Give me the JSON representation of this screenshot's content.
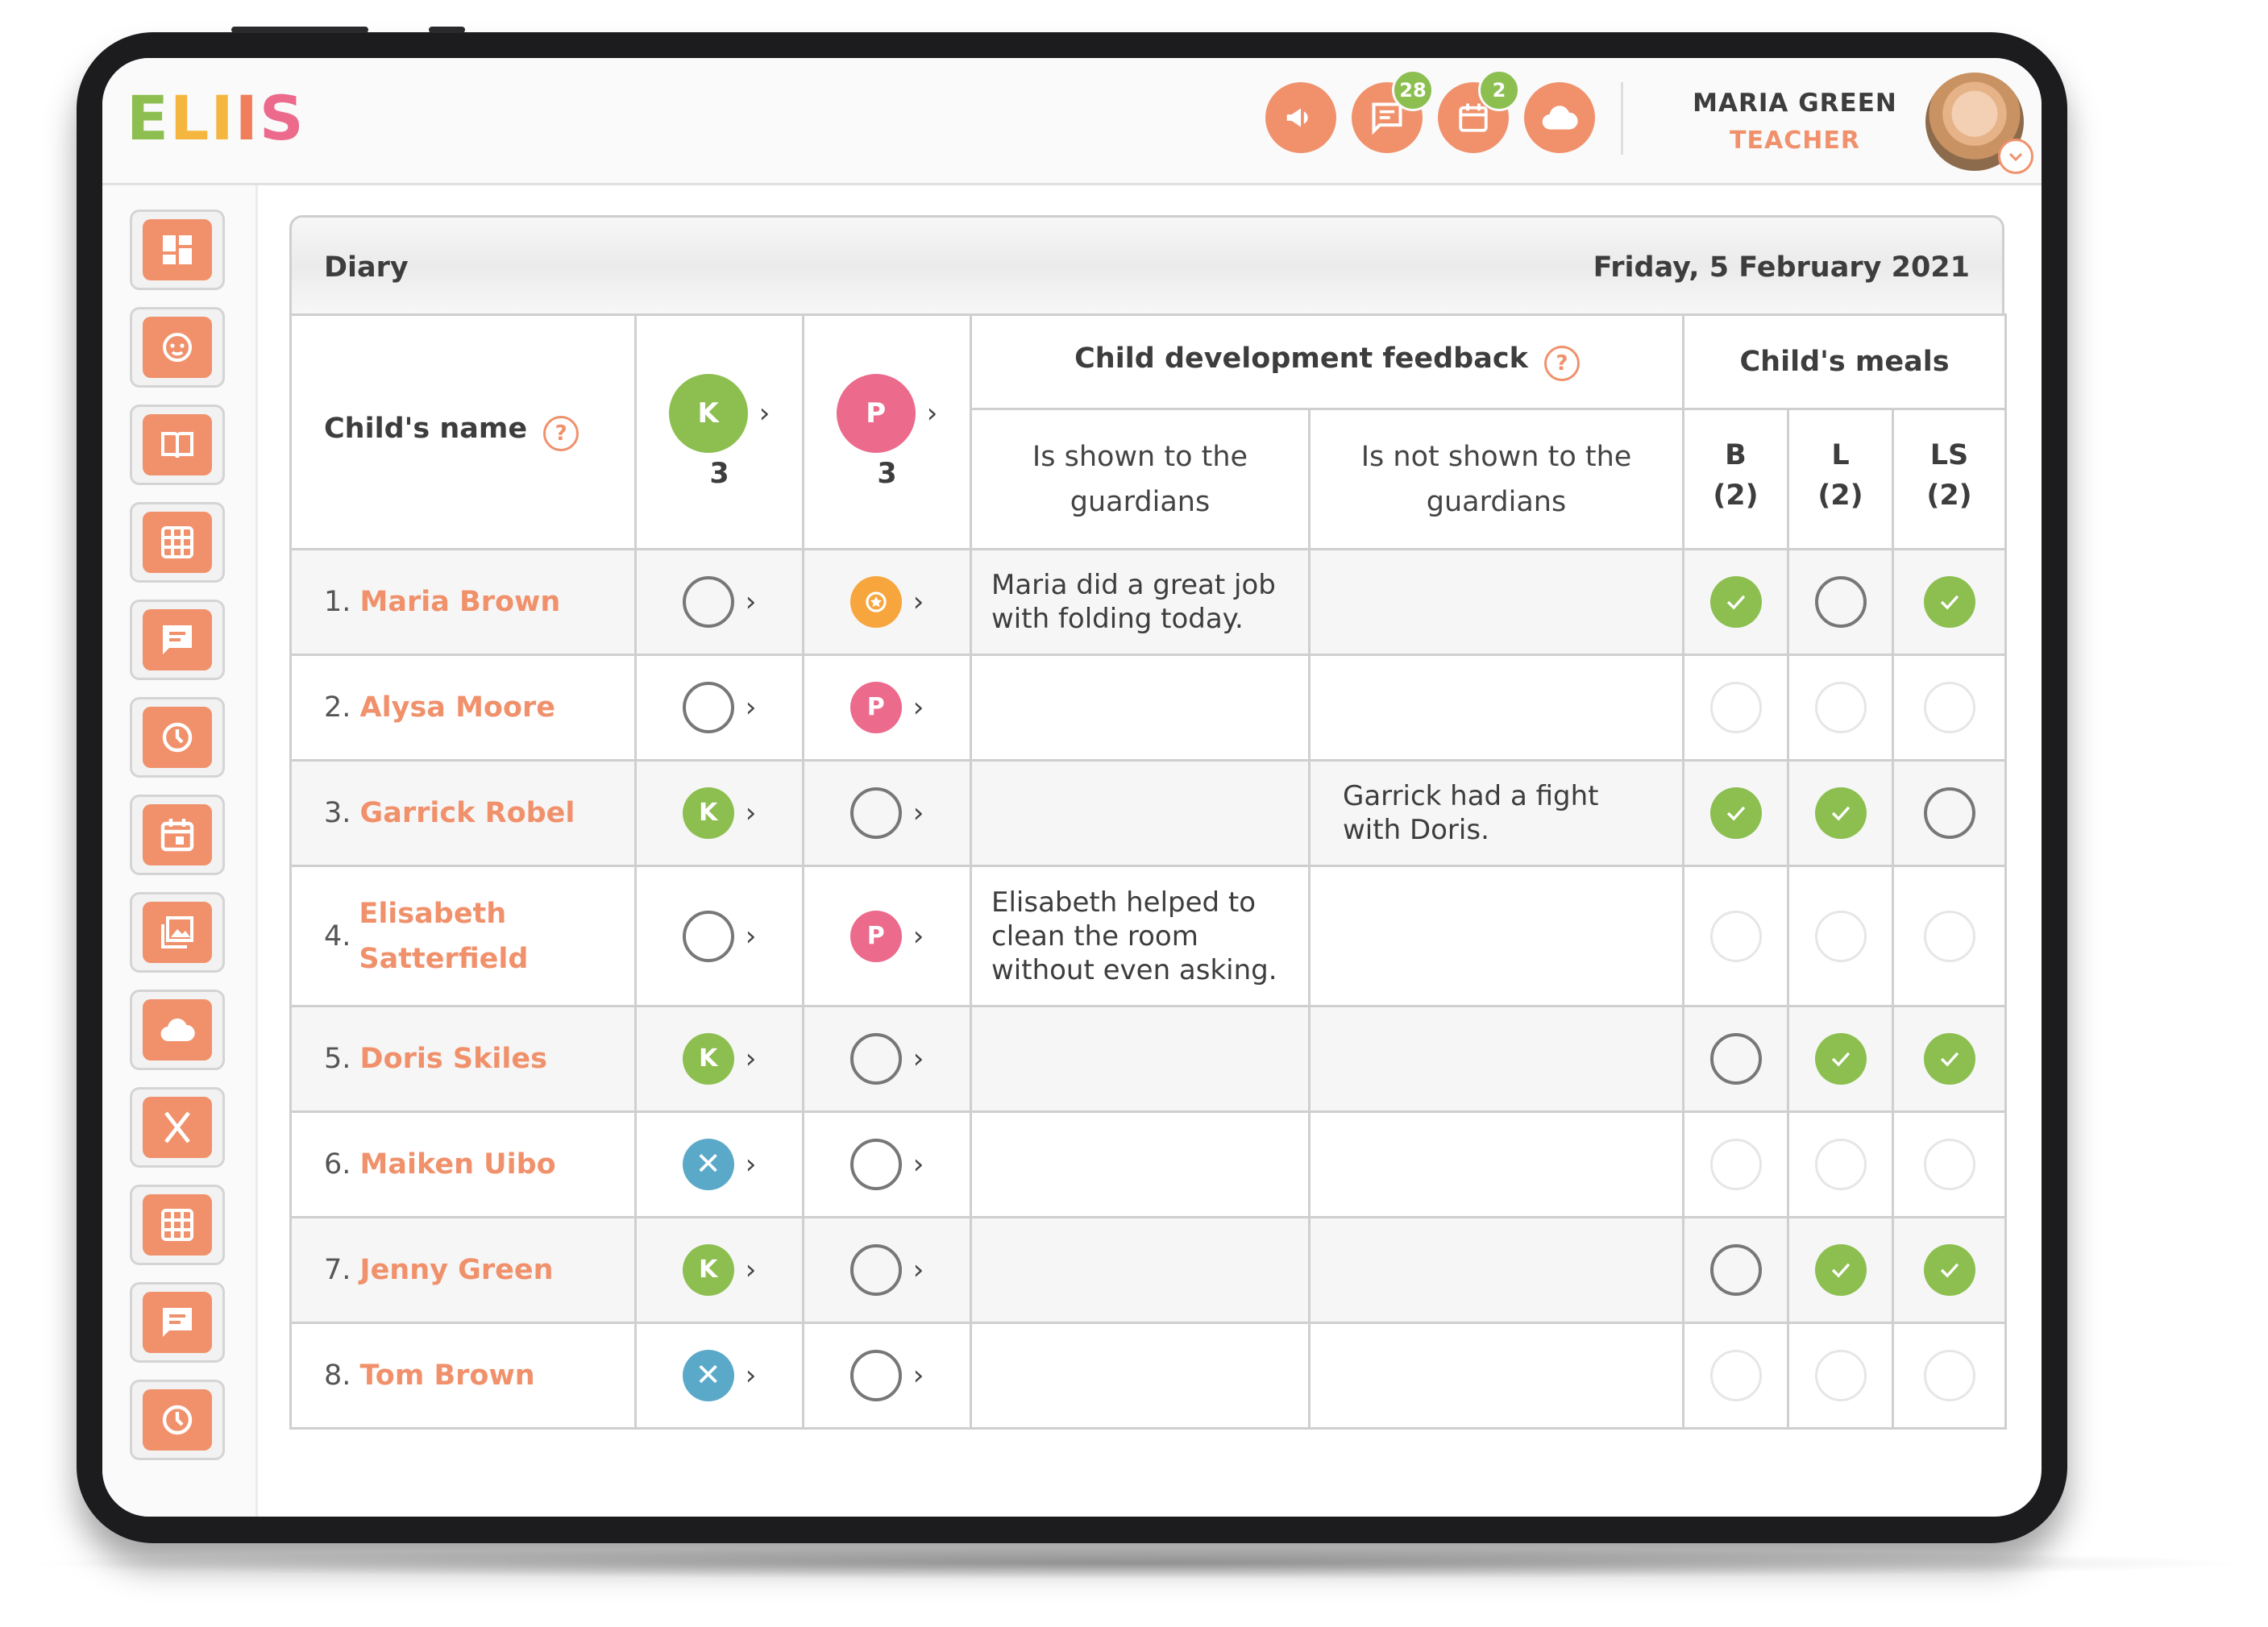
{
  "app": {
    "logo_letters": [
      "E",
      "L",
      "I",
      "I",
      "S"
    ],
    "logo_colors": [
      "#8cbf50",
      "#f4b63f",
      "#f4b63f",
      "#ef7f5b",
      "#ec6a8c"
    ]
  },
  "header": {
    "messages_badge": "28",
    "calendar_badge": "2",
    "user_name": "MARIA GREEN",
    "user_role": "TEACHER",
    "icons": [
      "megaphone-icon",
      "chat-icon",
      "calendar-icon",
      "cloud-icon"
    ]
  },
  "sidebar": {
    "icons": [
      "dashboard-icon",
      "child-face-icon",
      "book-icon",
      "grid-icon",
      "chat-icon",
      "clock-icon",
      "calendar-icon",
      "gallery-icon",
      "cloud-icon",
      "cutlery-icon",
      "grid-icon",
      "chat-icon",
      "clock-icon"
    ]
  },
  "diary": {
    "title": "Diary",
    "date": "Friday, 5 February 2021",
    "col_name": "Child's name",
    "col_k": {
      "letter": "K",
      "count": "3"
    },
    "col_p": {
      "letter": "P",
      "count": "3"
    },
    "col_feedback": "Child development feedback",
    "col_shown": "Is shown to the guardians",
    "col_not_shown": "Is not shown to the guardians",
    "col_meals": "Child's meals",
    "meals": [
      {
        "code": "B",
        "count": "(2)"
      },
      {
        "code": "L",
        "count": "(2)"
      },
      {
        "code": "LS",
        "count": "(2)"
      }
    ]
  },
  "rows": [
    {
      "num": "1.",
      "name": "Maria Brown",
      "k": "empty",
      "p": "star",
      "shown": "Maria did a great job with folding today.",
      "not_shown": "",
      "meals": [
        "check",
        "empty",
        "check"
      ]
    },
    {
      "num": "2.",
      "name": "Alysa Moore",
      "k": "empty",
      "p": "P",
      "shown": "",
      "not_shown": "",
      "meals": [
        "faint",
        "faint",
        "faint"
      ]
    },
    {
      "num": "3.",
      "name": "Garrick Robel",
      "k": "K",
      "p": "empty",
      "shown": "",
      "not_shown": "Garrick had a fight with Doris.",
      "meals": [
        "check",
        "check",
        "empty"
      ]
    },
    {
      "num": "4.",
      "name": "Elisabeth Satterfield",
      "k": "empty",
      "p": "P",
      "shown": "Elisabeth helped to clean the room without even asking.",
      "not_shown": "",
      "meals": [
        "faint",
        "faint",
        "faint"
      ]
    },
    {
      "num": "5.",
      "name": "Doris Skiles",
      "k": "K",
      "p": "empty",
      "shown": "",
      "not_shown": "",
      "meals": [
        "empty",
        "check",
        "check"
      ]
    },
    {
      "num": "6.",
      "name": "Maiken Uibo",
      "k": "X",
      "p": "empty",
      "shown": "",
      "not_shown": "",
      "meals": [
        "faint",
        "faint",
        "faint"
      ]
    },
    {
      "num": "7.",
      "name": "Jenny Green",
      "k": "K",
      "p": "empty",
      "shown": "",
      "not_shown": "",
      "meals": [
        "empty",
        "check",
        "check"
      ]
    },
    {
      "num": "8.",
      "name": "Tom Brown",
      "k": "X",
      "p": "empty",
      "shown": "",
      "not_shown": "",
      "meals": [
        "faint",
        "faint",
        "faint"
      ]
    }
  ],
  "colors": {
    "accent": "#f0916c",
    "green": "#8cbf50",
    "pink": "#ec6a8c",
    "blue": "#5ba9c9",
    "orange": "#f7a53d"
  }
}
